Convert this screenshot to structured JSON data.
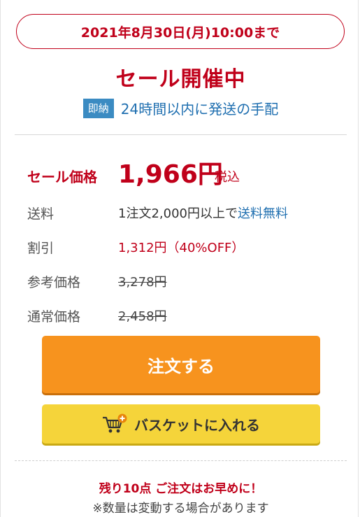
{
  "deadline": "2021年8月30日(月)10:00まで",
  "sale_heading": "セール開催中",
  "shipping_notice": {
    "badge": "即納",
    "text": "24時間以内に発送の手配"
  },
  "price": {
    "label": "セール価格",
    "value": "1,966円",
    "tax": "税込"
  },
  "details": {
    "shipping": {
      "label": "送料",
      "text": "1注文2,000円以上で",
      "link": "送料無料"
    },
    "discount": {
      "label": "割引",
      "value": "1,312円（40%OFF）"
    },
    "reference_price": {
      "label": "参考価格",
      "value": "3,278円"
    },
    "regular_price": {
      "label": "通常価格",
      "value": "2,458円"
    }
  },
  "buttons": {
    "order": "注文する",
    "basket": "バスケットに入れる"
  },
  "stock": {
    "note": "残り10点 ご注文はお早めに！",
    "sub": "※数量は変動する場合があります"
  },
  "colors": {
    "accent_red": "#c0001a",
    "link_blue": "#1f6fb0",
    "order_orange": "#f7931e",
    "basket_yellow": "#f5d43a"
  },
  "icons": {
    "basket": "cart-plus-icon"
  }
}
